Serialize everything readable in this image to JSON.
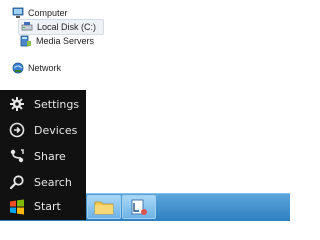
{
  "nav_tree": {
    "items": [
      {
        "label": "Computer",
        "icon": "computer-icon"
      },
      {
        "label": "Local Disk (C:)",
        "icon": "drive-icon",
        "selected": true
      },
      {
        "label": "Media Servers",
        "icon": "media-server-icon"
      },
      {
        "label": "Network",
        "icon": "network-icon"
      }
    ]
  },
  "charms": {
    "items": [
      {
        "label": "Settings",
        "icon": "gear-icon"
      },
      {
        "label": "Devices",
        "icon": "devices-icon"
      },
      {
        "label": "Share",
        "icon": "share-icon"
      },
      {
        "label": "Search",
        "icon": "search-icon"
      }
    ],
    "start_label": "Start"
  },
  "taskbar": {
    "buttons": [
      {
        "icon": "folder-icon"
      },
      {
        "icon": "libraries-icon"
      }
    ]
  },
  "colors": {
    "charms_bg": "#111111",
    "taskbar": "#3a8ccc",
    "selection": "#eef1f5"
  }
}
